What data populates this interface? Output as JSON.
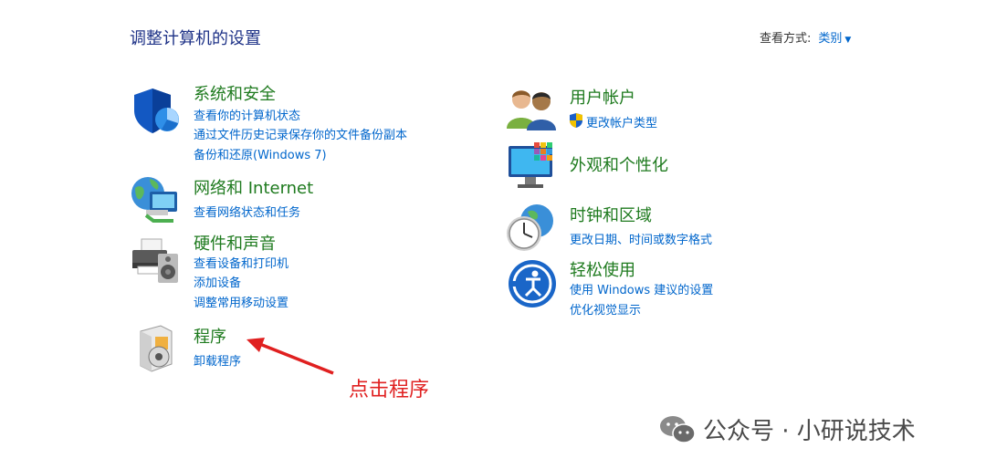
{
  "header": {
    "title": "调整计算机的设置",
    "view_by_label": "查看方式:",
    "view_by_value": "类别"
  },
  "left_categories": [
    {
      "title": "系统和安全",
      "icon": "shield-icon",
      "links": [
        "查看你的计算机状态",
        "通过文件历史记录保存你的文件备份副本",
        "备份和还原(Windows 7)"
      ]
    },
    {
      "title": "网络和 Internet",
      "icon": "network-globe-icon",
      "links": [
        "查看网络状态和任务"
      ]
    },
    {
      "title": "硬件和声音",
      "icon": "printer-speaker-icon",
      "links": [
        "查看设备和打印机",
        "添加设备",
        "调整常用移动设置"
      ]
    },
    {
      "title": "程序",
      "icon": "programs-box-icon",
      "links": [
        "卸载程序"
      ]
    }
  ],
  "right_categories": [
    {
      "title": "用户帐户",
      "icon": "users-icon",
      "links": [
        "更改帐户类型"
      ],
      "link_icon": "uac-shield-icon"
    },
    {
      "title": "外观和个性化",
      "icon": "monitor-palette-icon",
      "links": []
    },
    {
      "title": "时钟和区域",
      "icon": "clock-globe-icon",
      "links": [
        "更改日期、时间或数字格式"
      ]
    },
    {
      "title": "轻松使用",
      "icon": "ease-of-access-icon",
      "links": [
        "使用 Windows 建议的设置",
        "优化视觉显示"
      ]
    }
  ],
  "annotation": {
    "text": "点击程序",
    "color": "#e02020"
  },
  "watermark": {
    "text": "公众号 · 小研说技术",
    "icon": "wechat-icon"
  },
  "colors": {
    "title": "#1e3287",
    "category": "#1e7a1e",
    "link": "#0066cc"
  }
}
